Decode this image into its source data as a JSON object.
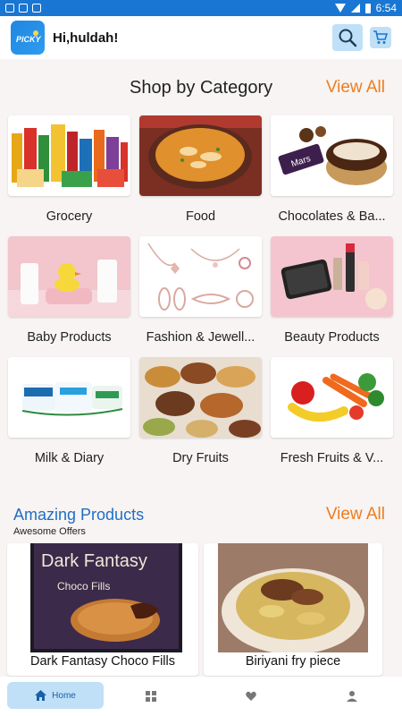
{
  "status_bar": {
    "time": "6:54"
  },
  "header": {
    "greeting": "Hi,huldah!",
    "logo_text": "PICKY"
  },
  "categories_section": {
    "title": "Shop by Category",
    "view_all": "View All",
    "items": [
      {
        "label": "Grocery",
        "icon": "grocery-image"
      },
      {
        "label": "Food",
        "icon": "food-image"
      },
      {
        "label": "Chocolates & Ba...",
        "icon": "chocolates-image"
      },
      {
        "label": "Baby Products",
        "icon": "baby-products-image"
      },
      {
        "label": "Fashion & Jewell...",
        "icon": "fashion-jewellery-image"
      },
      {
        "label": "Beauty  Products",
        "icon": "beauty-products-image"
      },
      {
        "label": "Milk & Diary",
        "icon": "milk-dairy-image"
      },
      {
        "label": "Dry Fruits",
        "icon": "dry-fruits-image"
      },
      {
        "label": "Fresh Fruits & V...",
        "icon": "fresh-fruits-image"
      }
    ]
  },
  "products_section": {
    "title": "Amazing Products",
    "subtitle": "Awesome Offers",
    "view_all": "View All",
    "items": [
      {
        "name": "Dark Fantasy Choco Fills",
        "box_text": "Dark Fantasy",
        "box_sub": "Choco Fills"
      },
      {
        "name": "Biriyani fry piece"
      }
    ]
  },
  "bottom_nav": {
    "home": "Home"
  },
  "colors": {
    "accent": "#1976d2",
    "orange": "#ef7c1e",
    "light_blue": "#bfe0f7",
    "link_blue": "#1f6fc4"
  }
}
